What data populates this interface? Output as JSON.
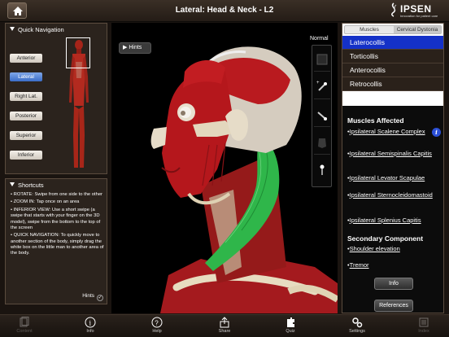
{
  "header": {
    "title": "Lateral: Head & Neck - L2",
    "logo_text": "IPSEN",
    "logo_tagline": "Innovation for patient care"
  },
  "quick_nav": {
    "heading": "Quick Navigation",
    "views": [
      "Anterior",
      "Lateral",
      "Right Lat.",
      "Posterior",
      "Superior",
      "Inferior"
    ],
    "active_view": "Lateral"
  },
  "shortcuts": {
    "heading": "Shortcuts",
    "items": [
      "• ROTATE: Swipe from one side to the other",
      "• ZOOM IN: Tap once on an area",
      "• INFERIOR VIEW: Use a short swipe (a swipe that starts with your finger on the 3D model), swipe from the bottom to the top of the screen",
      "• QUICK NAVIGATION: To quickly move to another section of the body, simply drag the white box on the little man to another area of the body."
    ],
    "hints_label": "Hints",
    "hints_checked": true
  },
  "viewer": {
    "hints_button": "Hints",
    "mode_label": "Normal",
    "tools": [
      "box-icon",
      "pin-add-icon",
      "pin-remove-icon",
      "muscle-icon",
      "pin-icon"
    ],
    "colors": {
      "muscle": "#b3141c",
      "highlight": "#2fb64a",
      "bone": "#e9dfc6"
    }
  },
  "right_panel": {
    "tabs": [
      "Muscles",
      "Cervical Dystonia"
    ],
    "active_tab": "Cervical Dystonia",
    "conditions": [
      "Laterocollis",
      "Torticollis",
      "Anterocollis",
      "Retrocollis"
    ],
    "selected_condition": "Laterocollis",
    "muscles_heading": "Muscles Affected",
    "muscles": [
      "Ipsilateral Scalene Complex",
      "Ipsilateral Semispinalis Capitis",
      "Ipsilateral Levator Scapulae",
      "Ipsilateral Sternocleidomastoid",
      "Ipsilateral Splenius Capitis"
    ],
    "secondary_heading": "Secondary Component",
    "secondary": [
      "Shoulder elevation",
      "Tremor"
    ],
    "info_button": "Info",
    "references_button": "References",
    "accent_color": "#1431c8"
  },
  "tabbar": {
    "tabs": [
      {
        "label": "Content",
        "icon": "content-icon",
        "enabled": false
      },
      {
        "label": "Info",
        "icon": "info-icon",
        "enabled": true
      },
      {
        "label": "Help",
        "icon": "help-icon",
        "enabled": true
      },
      {
        "label": "Share",
        "icon": "share-icon",
        "enabled": true
      },
      {
        "label": "Quiz",
        "icon": "quiz-icon",
        "enabled": true
      },
      {
        "label": "Settings",
        "icon": "settings-icon",
        "enabled": true
      },
      {
        "label": "Index",
        "icon": "index-icon",
        "enabled": false
      }
    ]
  }
}
